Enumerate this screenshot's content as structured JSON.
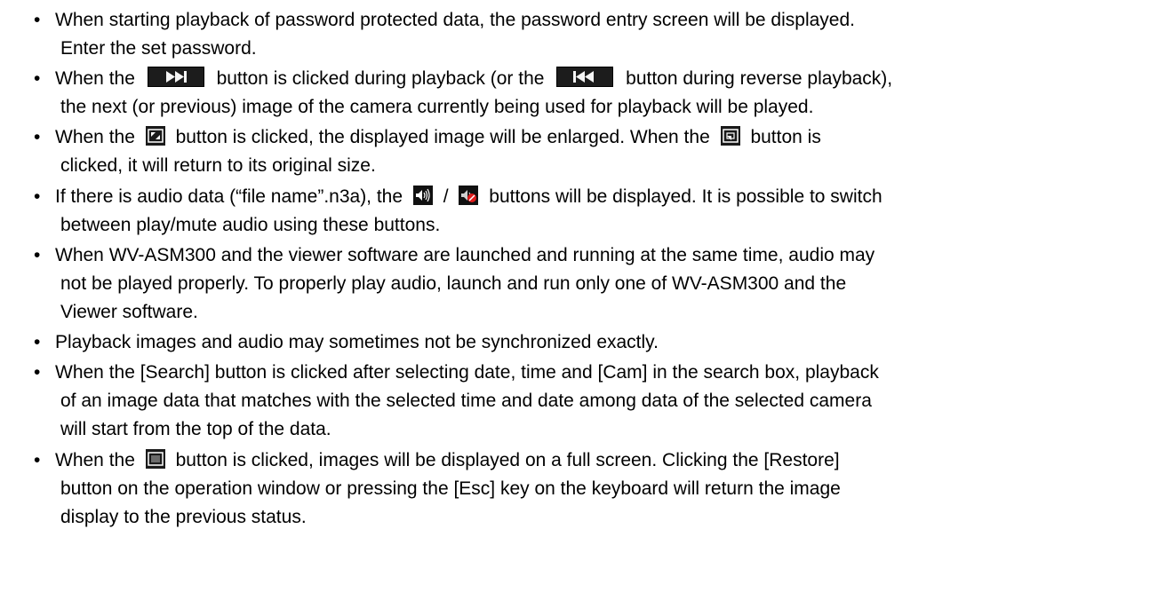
{
  "items": [
    {
      "lines": [
        "When starting playback of password protected data, the password entry screen will be displayed.",
        "Enter the set password."
      ]
    },
    {
      "seg": [
        "When the",
        "button is clicked during playback (or the",
        "button during reverse playback),"
      ],
      "cont": "the next (or previous) image of the camera currently being used for playback will be played.",
      "icons": [
        "fast-forward-icon",
        "rewind-icon"
      ]
    },
    {
      "seg": [
        "When the",
        "button is clicked, the displayed image will be enlarged.   When the",
        "button is"
      ],
      "cont": "clicked, it will return to its original size.",
      "icons": [
        "enlarge-icon",
        "restore-size-icon"
      ]
    },
    {
      "seg": [
        "If there is audio data (“file name”.n3a), the",
        "/",
        "buttons will be displayed. It is possible to switch"
      ],
      "cont": "between play/mute audio using these buttons.",
      "icons": [
        "speaker-icon",
        "mute-icon"
      ]
    },
    {
      "lines": [
        "When WV-ASM300 and the viewer software are launched and running at the same time, audio may",
        "not be played properly.   To properly play audio, launch and run only one of WV-ASM300 and the",
        "Viewer software."
      ]
    },
    {
      "lines": [
        "Playback images and audio may sometimes not be synchronized exactly."
      ]
    },
    {
      "lines": [
        "When the [Search] button is clicked after selecting date, time and [Cam] in the search box, playback",
        "of an image data that matches with the selected time and date among data of the selected camera",
        "will start from the top of the data."
      ]
    },
    {
      "seg": [
        "When the",
        "button is clicked, images will be displayed on a full screen. Clicking the [Restore]"
      ],
      "cont2": [
        "button on the operation window or pressing the [Esc] key on the keyboard will return the image",
        "display to the previous status."
      ],
      "icons": [
        "fullscreen-icon"
      ]
    }
  ],
  "bullet": "•"
}
